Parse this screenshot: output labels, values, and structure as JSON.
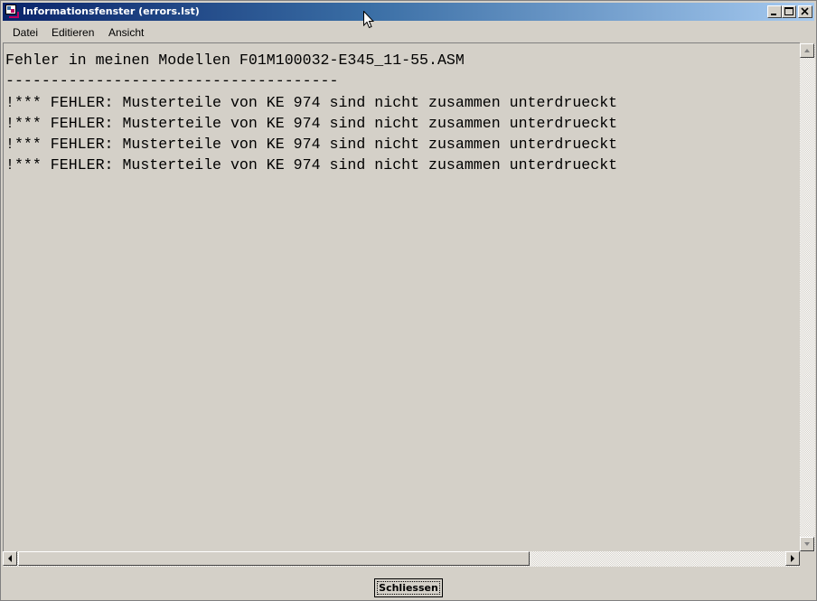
{
  "window": {
    "title": "Informationsfenster (errors.lst)",
    "icon": "app-icon"
  },
  "titlebar_buttons": [
    {
      "name": "minimize-button",
      "icon": "minimize-icon"
    },
    {
      "name": "maximize-button",
      "icon": "maximize-icon"
    },
    {
      "name": "close-window-button",
      "icon": "close-icon"
    }
  ],
  "menu": {
    "items": [
      "Datei",
      "Editieren",
      "Ansicht"
    ]
  },
  "content": {
    "lines": [
      "Fehler in meinen Modellen F01M100032-E345_11-55.ASM",
      "-------------------------------------",
      "!*** FEHLER: Musterteile von KE 974 sind nicht zusammen unterdrueckt",
      "!*** FEHLER: Musterteile von KE 974 sind nicht zusammen unterdrueckt",
      "!*** FEHLER: Musterteile von KE 974 sind nicht zusammen unterdrueckt",
      "!*** FEHLER: Musterteile von KE 974 sind nicht zusammen unterdrueckt"
    ]
  },
  "footer": {
    "close_label": "Schliessen"
  },
  "colors": {
    "titlebar_start": "#0a246a",
    "titlebar_end": "#a6caf0",
    "face": "#d4d0c8"
  }
}
